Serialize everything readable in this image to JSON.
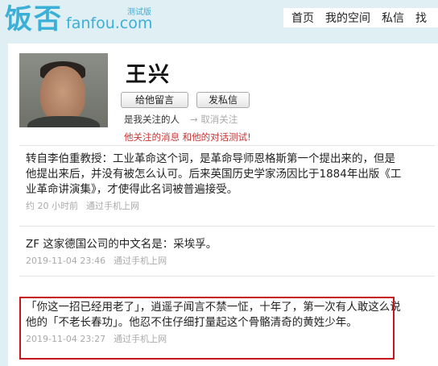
{
  "header": {
    "logo_cn": "饭否",
    "logo_en": "fanfou.com",
    "beta": "测试版",
    "nav": [
      "首页",
      "我的空间",
      "私信",
      "找"
    ]
  },
  "profile": {
    "name": "王兴",
    "btn_message": "给他留言",
    "btn_dm": "发私信",
    "follow_status": "是我关注的人",
    "unfollow": "→ 取消关注",
    "dialog_link": "他关注的消息 和他的对话测试!"
  },
  "posts": [
    {
      "text": "转自李伯重教授：工业革命这个词，是革命导师恩格斯第一个提出来的，但是他提出来后，并没有被怎么认可。后来英国历史学家汤因比于1884年出版《工业革命讲演集》，才使得此名词被普遍接受。",
      "time": "约 20 小时前",
      "source": "通过手机上网"
    },
    {
      "text": "ZF 这家德国公司的中文名是：采埃孚。",
      "time": "2019-11-04 23:46",
      "source": "通过手机上网"
    },
    {
      "text": "「你这一招已经用老了」，逍遥子闻言不禁一怔，十年了，第一次有人敢这么说他的「不老长春功」。他忍不住仔细打量起这个骨骼清奇的黄姓少年。",
      "time": "2019-11-04 23:27",
      "source": "通过手机上网"
    }
  ]
}
